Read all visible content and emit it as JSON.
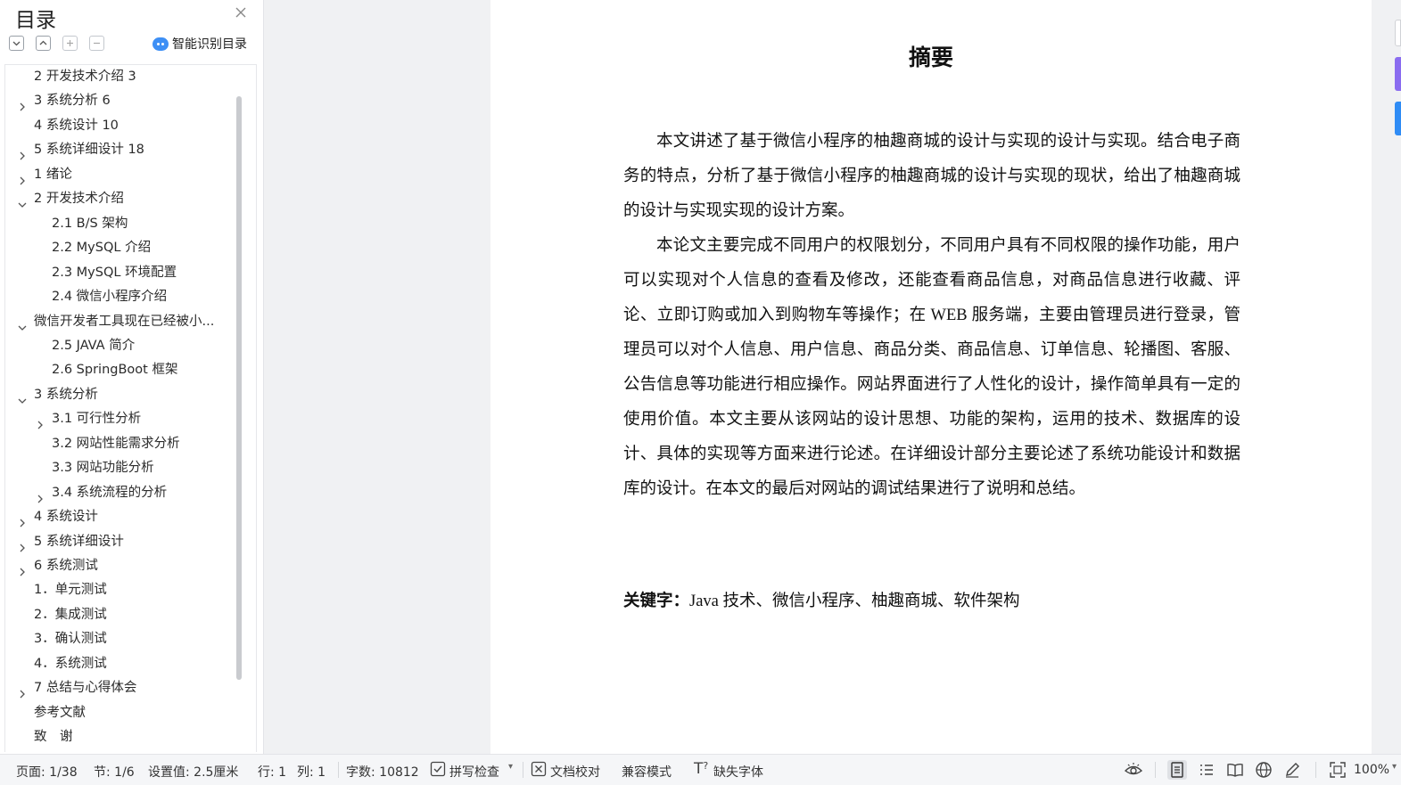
{
  "sidebar": {
    "title": "目录",
    "smart_toc_label": "智能识别目录",
    "toc": [
      {
        "label": "2 开发技术介绍 3",
        "expand": "none",
        "level": 1
      },
      {
        "label": "3 系统分析 6",
        "expand": "collapsed",
        "level": 1
      },
      {
        "label": "4 系统设计 10",
        "expand": "none",
        "level": 1
      },
      {
        "label": "5 系统详细设计 18",
        "expand": "collapsed",
        "level": 1
      },
      {
        "label": "1 绪论",
        "expand": "collapsed",
        "level": 1
      },
      {
        "label": "2 开发技术介绍",
        "expand": "expanded",
        "level": 1
      },
      {
        "label": "2.1 B/S 架构",
        "expand": "none",
        "level": 2
      },
      {
        "label": "2.2 MySQL 介绍",
        "expand": "none",
        "level": 2
      },
      {
        "label": "2.3 MySQL 环境配置",
        "expand": "none",
        "level": 2
      },
      {
        "label": "2.4  微信小程序介绍",
        "expand": "none",
        "level": 2
      },
      {
        "label": "微信开发者工具现在已经被小...",
        "expand": "expanded",
        "level": 1
      },
      {
        "label": "2.5 JAVA 简介",
        "expand": "none",
        "level": 2
      },
      {
        "label": "2.6 SpringBoot 框架",
        "expand": "none",
        "level": 2
      },
      {
        "label": "3 系统分析",
        "expand": "expanded",
        "level": 1
      },
      {
        "label": "3.1 可行性分析",
        "expand": "collapsed",
        "level": 2
      },
      {
        "label": "3.2 网站性能需求分析",
        "expand": "none",
        "level": 2
      },
      {
        "label": "3.3 网站功能分析",
        "expand": "none",
        "level": 2
      },
      {
        "label": "3.4 系统流程的分析",
        "expand": "collapsed",
        "level": 2
      },
      {
        "label": "4 系统设计",
        "expand": "collapsed",
        "level": 1
      },
      {
        "label": "5 系统详细设计",
        "expand": "collapsed",
        "level": 1
      },
      {
        "label": "6 系统测试",
        "expand": "collapsed",
        "level": 1
      },
      {
        "label": "1．单元测试",
        "expand": "none",
        "level": 1
      },
      {
        "label": "2．集成测试",
        "expand": "none",
        "level": 1
      },
      {
        "label": "3．确认测试",
        "expand": "none",
        "level": 1
      },
      {
        "label": "4．系统测试",
        "expand": "none",
        "level": 1
      },
      {
        "label": "7 总结与心得体会",
        "expand": "collapsed",
        "level": 1
      },
      {
        "label": "参考文献",
        "expand": "none",
        "level": 1
      },
      {
        "label": "致　谢",
        "expand": "none",
        "level": 1
      }
    ]
  },
  "document": {
    "title": "摘要",
    "paragraphs": [
      "本文讲述了基于微信小程序的柚趣商城的设计与实现的设计与实现。结合电子商务的特点，分析了基于微信小程序的柚趣商城的设计与实现的现状，给出了柚趣商城的设计与实现实现的设计方案。",
      "本论文主要完成不同用户的权限划分，不同用户具有不同权限的操作功能，用户可以实现对个人信息的查看及修改，还能查看商品信息，对商品信息进行收藏、评论、立即订购或加入到购物车等操作；在 WEB 服务端，主要由管理员进行登录，管理员可以对个人信息、用户信息、商品分类、商品信息、订单信息、轮播图、客服、公告信息等功能进行相应操作。网站界面进行了人性化的设计，操作简单具有一定的使用价值。本文主要从该网站的设计思想、功能的架构，运用的技术、数据库的设计、具体的实现等方面来进行论述。在详细设计部分主要论述了系统功能设计和数据库的设计。在本文的最后对网站的调试结果进行了说明和总结。"
    ],
    "keywords_label": "关键字：",
    "keywords_value": "Java 技术、微信小程序、柚趣商城、软件架构"
  },
  "statusbar": {
    "page": "页面: 1/38",
    "section": "节: 1/6",
    "setting": "设置值: 2.5厘米",
    "row": "行: 1",
    "col": "列: 1",
    "wordcount": "字数: 10812",
    "spellcheck": "拼写检查",
    "proofread": "文档校对",
    "compat": "兼容模式",
    "missing_font": "缺失字体",
    "zoom": "100%"
  },
  "colors": {
    "accent": "#3d8ff5",
    "right_tab_purple": "#8a6cf0",
    "right_tab_blue": "#2f8cf5"
  }
}
